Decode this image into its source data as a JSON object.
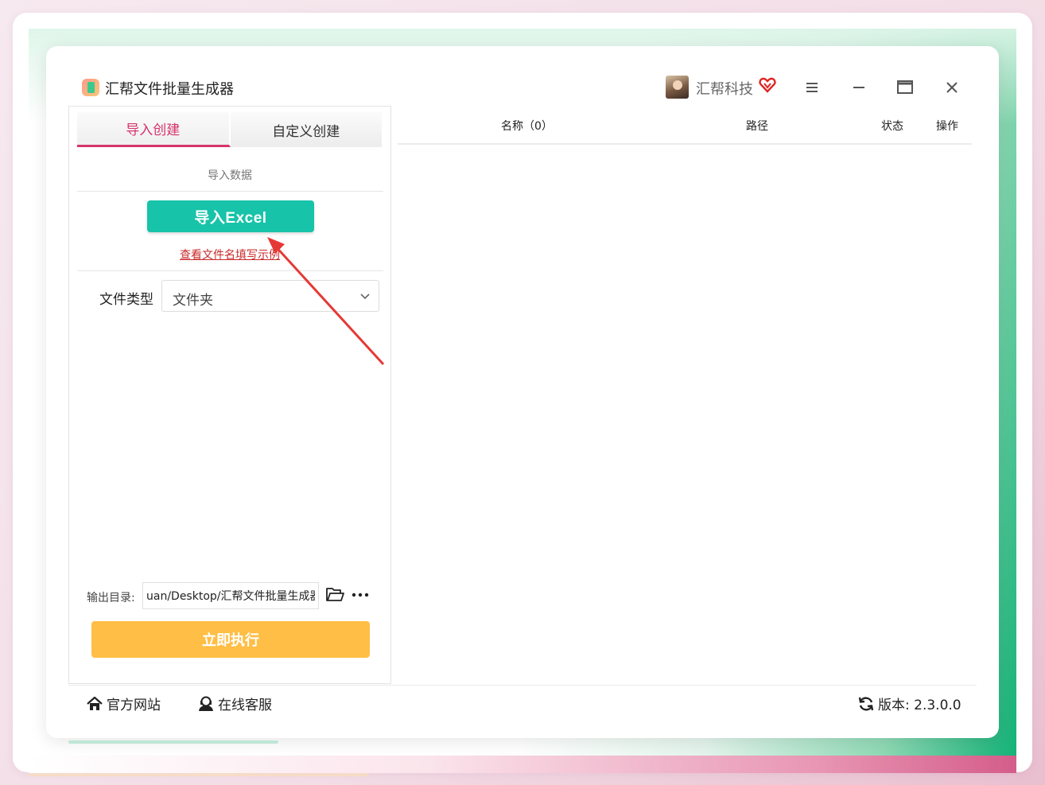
{
  "window": {
    "title": "汇帮文件批量生成器",
    "user_name": "汇帮科技"
  },
  "tabs": [
    {
      "label": "导入创建",
      "active": true
    },
    {
      "label": "自定义创建",
      "active": false
    }
  ],
  "import_section": {
    "label": "导入数据",
    "import_button": "导入Excel",
    "example_link": "查看文件名填写示例"
  },
  "file_type": {
    "label": "文件类型",
    "selected": "文件夹"
  },
  "output": {
    "label": "输出目录:",
    "path": "uan/Desktop/汇帮文件批量生成器"
  },
  "execute_button": "立即执行",
  "table": {
    "columns": [
      "名称（0）",
      "路径",
      "状态",
      "操作"
    ]
  },
  "footer": {
    "website": "官方网站",
    "support": "在线客服",
    "version": "版本:  2.3.0.0"
  },
  "colors": {
    "accent_pink": "#d6336c",
    "import_button": "#17c3a9",
    "execute_button": "#ffbe45",
    "link_red": "#c92a2a",
    "annotation_arrow": "#e53935"
  },
  "icons": [
    "vip-heart-icon",
    "menu-icon",
    "minimize-icon",
    "maximize-icon",
    "close-icon",
    "chevron-down-icon",
    "folder-icon",
    "more-icon",
    "home-icon",
    "support-icon",
    "refresh-icon"
  ]
}
